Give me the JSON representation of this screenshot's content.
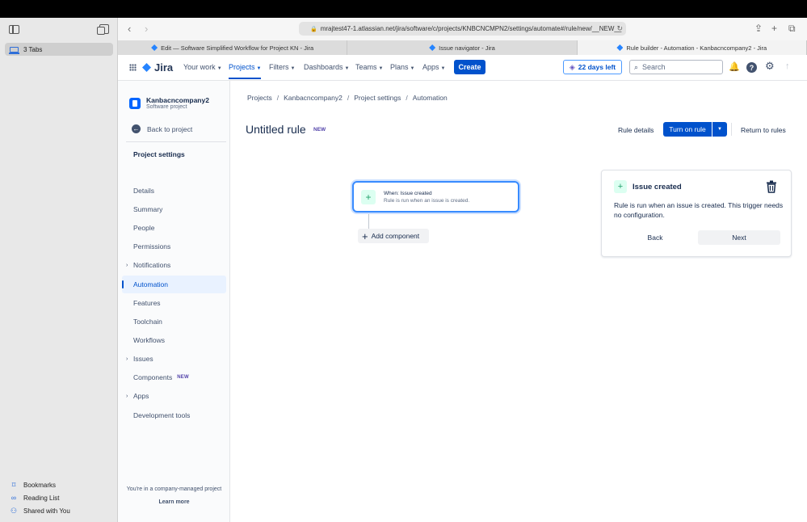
{
  "safari": {
    "tab_group_label": "3 Tabs",
    "bookmarks": "Bookmarks",
    "reading_list": "Reading List",
    "shared": "Shared with You"
  },
  "browser": {
    "url": "mrajtest47-1.atlassian.net/jira/software/c/projects/KNBCNCMPN2/settings/automate#/rule/new/__NEW__",
    "tabs": [
      {
        "title": "Edit — Software Simplified Workflow for Project KN - Jira"
      },
      {
        "title": "Issue navigator - Jira"
      },
      {
        "title": "Rule builder - Automation - Kanbacncompany2 - Jira"
      }
    ]
  },
  "header": {
    "logo": "Jira",
    "nav": [
      "Your work",
      "Projects",
      "Filters",
      "Dashboards",
      "Teams",
      "Plans",
      "Apps"
    ],
    "create": "Create",
    "trial": "22 days left",
    "search_placeholder": "Search"
  },
  "sidebar": {
    "project_name": "Kanbacncompany2",
    "project_type": "Software project",
    "back": "Back to project",
    "heading": "Project settings",
    "items": [
      {
        "label": "Details"
      },
      {
        "label": "Summary"
      },
      {
        "label": "People"
      },
      {
        "label": "Permissions"
      },
      {
        "label": "Notifications"
      },
      {
        "label": "Automation"
      },
      {
        "label": "Features"
      },
      {
        "label": "Toolchain"
      },
      {
        "label": "Workflows"
      },
      {
        "label": "Issues"
      },
      {
        "label": "Components",
        "badge": "NEW"
      },
      {
        "label": "Apps"
      },
      {
        "label": "Development tools"
      }
    ],
    "footer_text": "You're in a company-managed project",
    "footer_link": "Learn more"
  },
  "main": {
    "breadcrumbs": [
      "Projects",
      "Kanbacncompany2",
      "Project settings",
      "Automation"
    ],
    "title": "Untitled rule",
    "title_badge": "NEW",
    "rule_details": "Rule details",
    "turn_on": "Turn on rule",
    "return": "Return to rules",
    "trigger_title": "When: Issue created",
    "trigger_sub": "Rule is run when an issue is created.",
    "add_component": "Add component"
  },
  "panel": {
    "title": "Issue created",
    "description": "Rule is run when an issue is created. This trigger needs no configuration.",
    "back": "Back",
    "next": "Next"
  },
  "colors": {
    "primary": "#0052cc",
    "success_icon": "#22a06b",
    "selected_border": "#388bff"
  }
}
